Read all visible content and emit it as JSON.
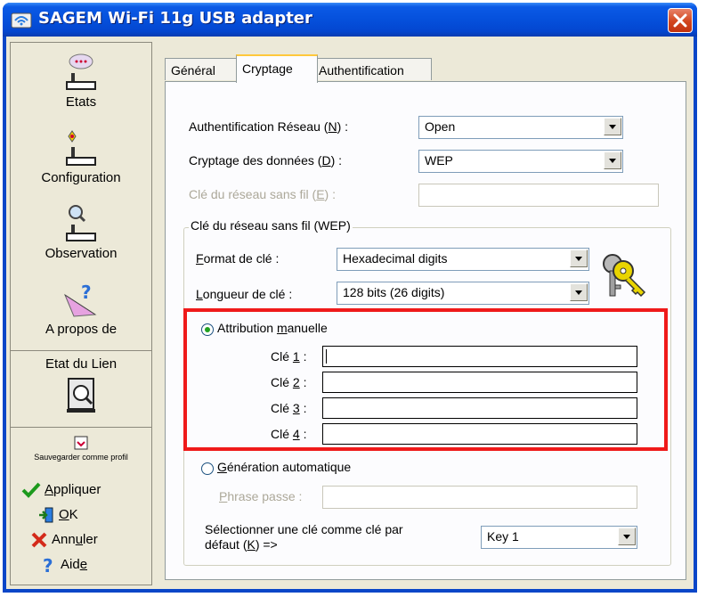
{
  "window": {
    "title": "SAGEM Wi-Fi 11g USB adapter"
  },
  "sidebar": {
    "nav": [
      {
        "label": "Etats",
        "icon": "status-router-icon"
      },
      {
        "label": "Configuration",
        "icon": "configuration-router-icon"
      },
      {
        "label": "Observation",
        "icon": "observation-router-icon"
      },
      {
        "label": "A propos de",
        "icon": "about-help-icon"
      }
    ],
    "link_state": {
      "label": "Etat du Lien",
      "icon": "link-state-icon"
    },
    "save_profile": {
      "label": "Sauvegarder comme profil",
      "icon": "save-profile-icon"
    },
    "actions": [
      {
        "pre": "",
        "u": "A",
        "post": "ppliquer",
        "icon": "checkmark-icon"
      },
      {
        "pre": "",
        "u": "O",
        "post": "K",
        "icon": "ok-door-icon"
      },
      {
        "pre": "Ann",
        "u": "u",
        "post": "ler",
        "icon": "cancel-x-icon"
      },
      {
        "pre": "Aid",
        "u": "e",
        "post": "",
        "icon": "help-question-icon"
      }
    ]
  },
  "tabs": [
    "Général",
    "Cryptage",
    "Authentification"
  ],
  "active_tab": "Cryptage",
  "form": {
    "auth": {
      "pre": "Authentification Réseau (",
      "u": "N",
      "post": ") :",
      "value": "Open"
    },
    "encryption": {
      "pre": "Cryptage des données (",
      "u": "D",
      "post": ") :",
      "value": "WEP"
    },
    "network_key": {
      "pre": "Clé du réseau sans fil  (",
      "u": "E",
      "post": ") :",
      "value": ""
    },
    "wep_group": {
      "title": "Clé du réseau sans fil (WEP)",
      "key_format": {
        "pre": "",
        "u": "F",
        "post": "ormat de clé :",
        "value": "Hexadecimal digits"
      },
      "key_length": {
        "pre": "",
        "u": "L",
        "post": "ongueur de clé :",
        "value": "128 bits (26 digits)"
      },
      "manual": {
        "pre": "Attribution ",
        "u": "m",
        "post": "anuelle",
        "checked": true
      },
      "keys": [
        {
          "pre": "Clé ",
          "u": "1",
          "post": " :",
          "value": ""
        },
        {
          "pre": "Clé ",
          "u": "2",
          "post": " :",
          "value": ""
        },
        {
          "pre": "Clé ",
          "u": "3",
          "post": " :",
          "value": ""
        },
        {
          "pre": "Clé ",
          "u": "4",
          "post": " :",
          "value": ""
        }
      ],
      "auto": {
        "pre": "",
        "u": "G",
        "post": "énération automatique",
        "checked": false
      },
      "passphrase": {
        "pre": "",
        "u": "P",
        "post": "hrase passe :",
        "value": ""
      },
      "default_key": {
        "line1": "Sélectionner une clé comme clé par",
        "line2_pre": "défaut (",
        "line2_u": "K",
        "line2_post": ") =>",
        "value": "Key 1"
      }
    }
  },
  "highlight_color": "#ef1a1a"
}
